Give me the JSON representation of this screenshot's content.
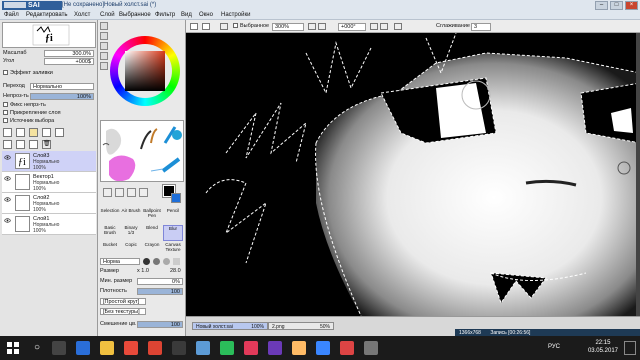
{
  "app": {
    "logo": "SAI",
    "title": "[Не сохранено]Новый холст.sai (*)"
  },
  "menu": [
    "Файл",
    "Редактировать",
    "Холст",
    "Слой",
    "Выбранное",
    "Фильтр",
    "Вид",
    "Окно",
    "Настройки"
  ],
  "navigator": {
    "zoom_label": "Масштаб",
    "zoom_value": "300.0%",
    "angle_label": "Угол",
    "angle_value": "+000$"
  },
  "layer_props": {
    "effect_label": "Эффект заливки",
    "blend_label": "Переход",
    "blend_value": "Нормально",
    "opacity_label": "Непроз-ть",
    "opacity_value": "100%",
    "options": [
      "Фикс непрз-ть",
      "Прикрепление слоя",
      "Источник выбора"
    ]
  },
  "layers": [
    {
      "name": "Слой3",
      "mode": "Нормально",
      "opacity": "100%",
      "selected": true
    },
    {
      "name": "Вектор1",
      "mode": "Нормально",
      "opacity": "100%",
      "selected": false
    },
    {
      "name": "Слой2",
      "mode": "Нормально",
      "opacity": "100%",
      "selected": false
    },
    {
      "name": "Слой1",
      "mode": "Нормально",
      "opacity": "100%",
      "selected": false
    }
  ],
  "tools": [
    [
      "Selection",
      "Air Brush",
      "Ballpoint Pen",
      "Pencil"
    ],
    [
      "Basic Brush",
      "Binary 1/3",
      "Blend",
      "Blur"
    ],
    [
      "Bucket",
      "Copic",
      "Crayon",
      "Canvas Texture"
    ]
  ],
  "brush": {
    "mode_value": "Норма",
    "size_label": "Размер",
    "size_mult": "x 1.0",
    "size_value": "28.0",
    "min_size_label": "Мин. размер",
    "min_size_value": "0%",
    "density_label": "Плотность",
    "density_value": "100",
    "shape_value": "[Простой круг]",
    "texture_value": "[Без текстуры]",
    "blend_label": "Смешение цв.",
    "blend_value": "100"
  },
  "canvas_toolbar": {
    "selection_label": "Выбранное",
    "zoom_value": "300%",
    "angle_value": "+000°",
    "smoothing_label": "Сглаживание",
    "smoothing_value": "3"
  },
  "documents": [
    {
      "name": "Новый холст.sai",
      "zoom": "100%",
      "active": true
    },
    {
      "name": "2.png",
      "zoom": "50%",
      "active": false
    }
  ],
  "status": {
    "resolution": "1366x768",
    "recording": "Запись [00:26:56]"
  },
  "taskbar": {
    "time": "22:15",
    "date": "03.05.2017",
    "lang": "РУС"
  },
  "colors": {
    "accent": "#2f5f9a",
    "layer_selected": "#cfd2f7",
    "taskbar": "#1b1b1b"
  }
}
